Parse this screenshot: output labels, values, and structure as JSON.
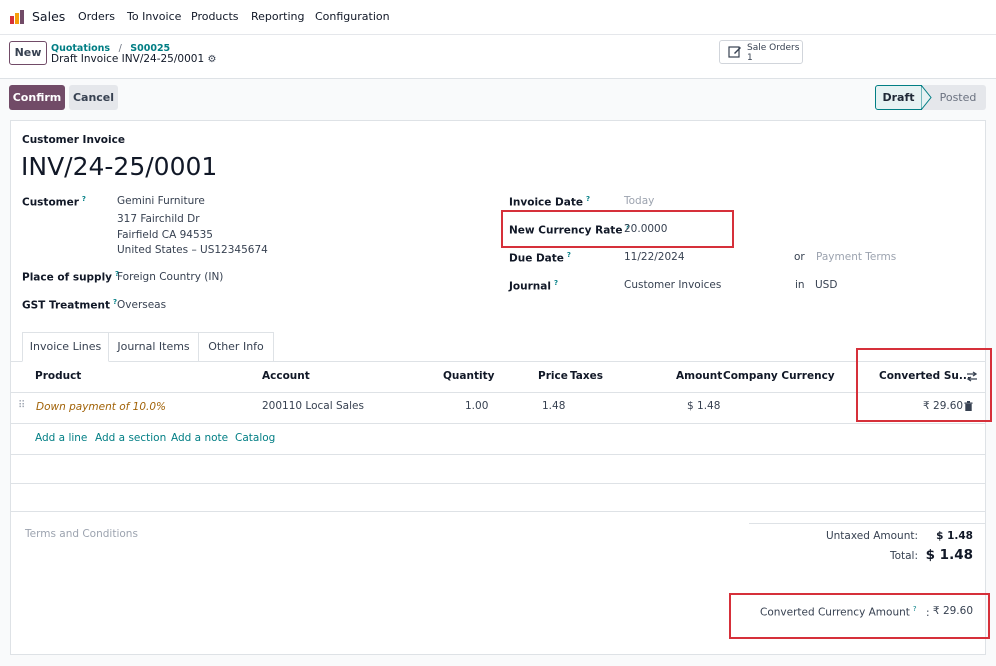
{
  "nav": {
    "app_name": "Sales",
    "menu": [
      "Orders",
      "To Invoice",
      "Products",
      "Reporting",
      "Configuration"
    ]
  },
  "control": {
    "new_label": "New",
    "breadcrumb": {
      "root": "Quotations",
      "sep": "/",
      "parent": "S00025",
      "current": "Draft Invoice INV/24-25/0001"
    },
    "smart_button": {
      "label": "Sale Orders",
      "count": "1"
    }
  },
  "actions": {
    "confirm": "Confirm",
    "cancel": "Cancel"
  },
  "status": {
    "draft": "Draft",
    "posted": "Posted"
  },
  "invoice": {
    "type": "Customer Invoice",
    "number": "INV/24-25/0001",
    "customer_label": "Customer",
    "customer_name": "Gemini Furniture",
    "address1": "317 Fairchild Dr",
    "address2": "Fairfield CA 94535",
    "address3": "United States – US12345674",
    "place_label": "Place of supply",
    "place_value": "Foreign Country (IN)",
    "gst_label": "GST Treatment",
    "gst_value": "Overseas",
    "date_label": "Invoice Date",
    "date_value": "Today",
    "rate_label": "New Currency Rate",
    "rate_value": "20.0000",
    "due_label": "Due Date",
    "due_value": "11/22/2024",
    "or": "or",
    "payment_terms": "Payment Terms",
    "journal_label": "Journal",
    "journal_value": "Customer Invoices",
    "in": "in",
    "currency": "USD"
  },
  "tabs": [
    "Invoice Lines",
    "Journal Items",
    "Other Info"
  ],
  "table": {
    "headers": {
      "product": "Product",
      "account": "Account",
      "quantity": "Quantity",
      "price": "Price",
      "taxes": "Taxes",
      "amount": "Amount",
      "company_currency": "Company Currency",
      "converted": "Converted Su..."
    },
    "row": {
      "product": "Down payment of 10.0%",
      "account": "200110 Local Sales",
      "quantity": "1.00",
      "price": "1.48",
      "amount": "$ 1.48",
      "converted": "₹ 29.60"
    }
  },
  "add_links": [
    "Add a line",
    "Add a section",
    "Add a note",
    "Catalog"
  ],
  "terms_placeholder": "Terms and Conditions",
  "totals": {
    "untaxed_label": "Untaxed Amount:",
    "untaxed_value": "$ 1.48",
    "total_label": "Total:",
    "total_value": "$ 1.48",
    "converted_label": "Converted Currency Amount",
    "converted_colon": ":",
    "converted_value": "₹ 29.60"
  },
  "colors": {
    "primary": "#714b67",
    "link": "#017e84",
    "highlight": "#d6303a"
  }
}
